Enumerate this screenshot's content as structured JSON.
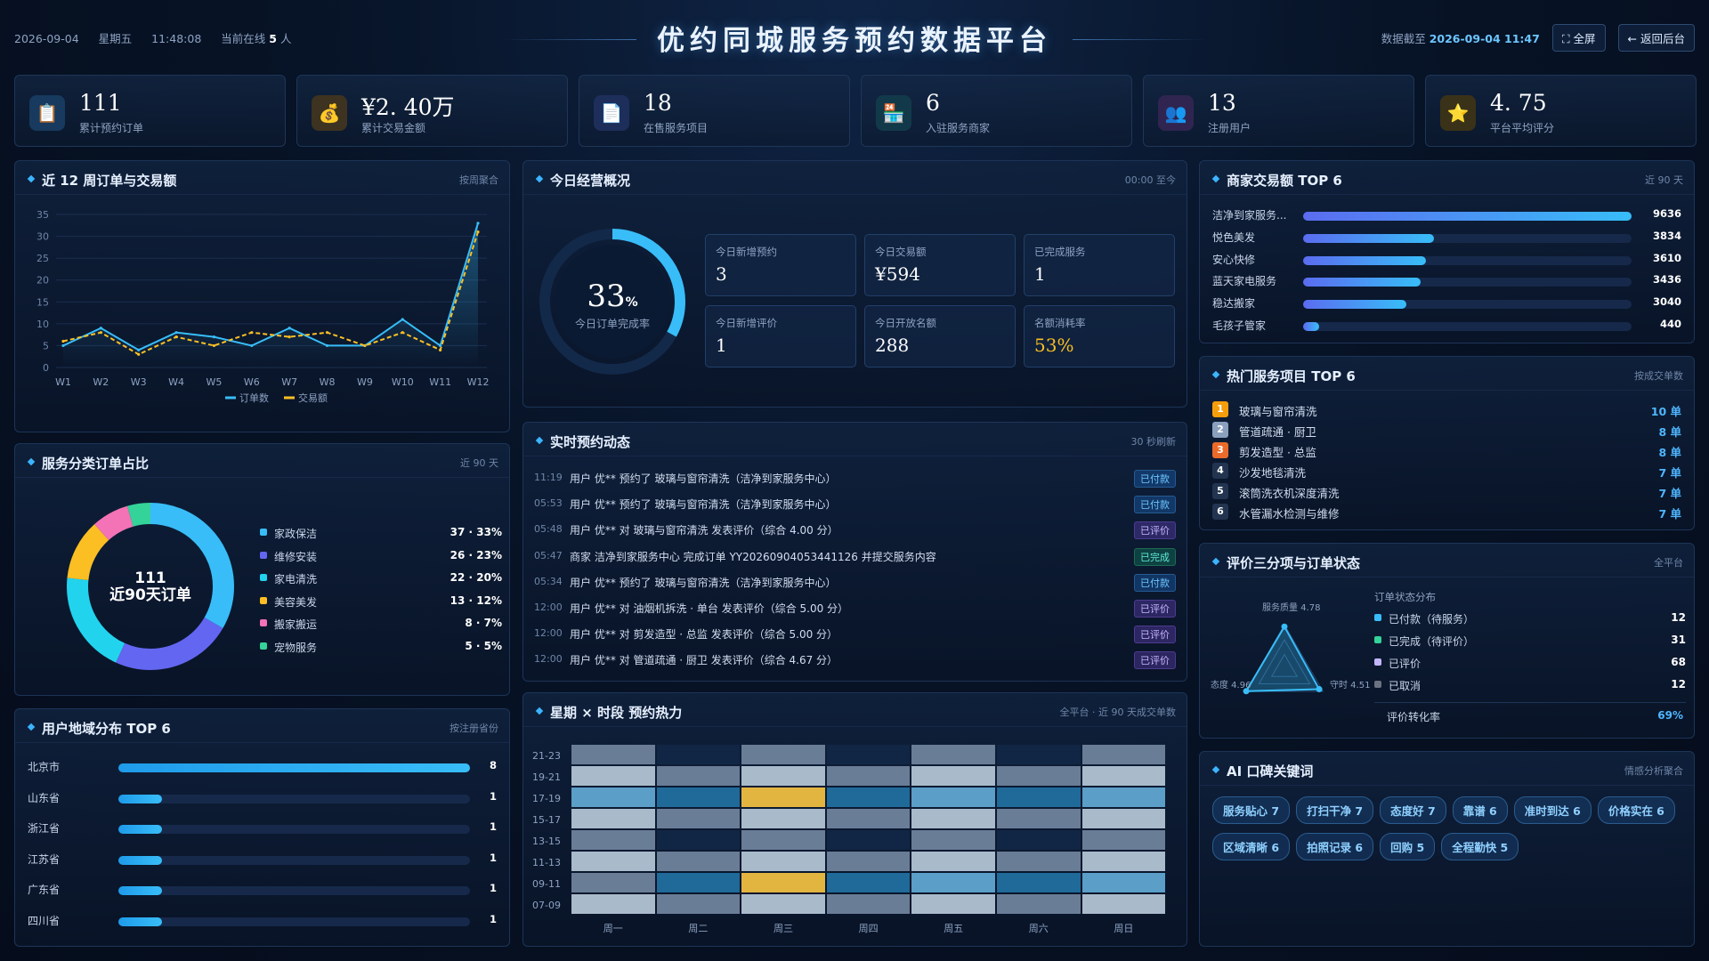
{
  "header": {
    "date": "2026-09-04",
    "weekday": "星期五",
    "time": "11:48:08",
    "online_prefix": "当前在线",
    "online_count": "5",
    "online_suffix": "人",
    "title": "优约同城服务预约数据平台",
    "data_as_of_label": "数据截至",
    "data_as_of": "2026-09-04 11:47",
    "fullscreen_label": "⛶ 全屏",
    "back_label": "← 返回后台"
  },
  "stats": [
    {
      "value": "111",
      "label": "累计预约订单",
      "icon": "clipboard-icon",
      "glyph": "📋",
      "bg": "#173a5e"
    },
    {
      "value": "¥2. 40万",
      "label": "累计交易金额",
      "icon": "money-bag-icon",
      "glyph": "💰",
      "bg": "#3d3320"
    },
    {
      "value": "18",
      "label": "在售服务项目",
      "icon": "document-icon",
      "glyph": "📄",
      "bg": "#1d2e5a"
    },
    {
      "value": "6",
      "label": "入驻服务商家",
      "icon": "store-icon",
      "glyph": "🏪",
      "bg": "#12394a"
    },
    {
      "value": "13",
      "label": "注册用户",
      "icon": "users-icon",
      "glyph": "👥",
      "bg": "#2f2550"
    },
    {
      "value": "4. 75",
      "label": "平台平均评分",
      "icon": "star-icon",
      "glyph": "⭐",
      "bg": "#3a3218"
    }
  ],
  "weekly": {
    "title": "近 12 周订单与交易额",
    "subtitle": "按周聚合",
    "legend_orders": "订单数",
    "legend_amount": "交易额"
  },
  "category": {
    "title": "服务分类订单占比",
    "subtitle": "近 90 天",
    "center_value": "111",
    "center_label": "近90天订单",
    "items": [
      {
        "name": "家政保洁",
        "count": 37,
        "pct": "33%",
        "display": "37 · 33%",
        "color": "#38bdf8"
      },
      {
        "name": "维修安装",
        "count": 26,
        "pct": "23%",
        "display": "26 · 23%",
        "color": "#6366f1"
      },
      {
        "name": "家电清洗",
        "count": 22,
        "pct": "20%",
        "display": "22 · 20%",
        "color": "#22d3ee"
      },
      {
        "name": "美容美发",
        "count": 13,
        "pct": "12%",
        "display": "13 · 12%",
        "color": "#fbbf24"
      },
      {
        "name": "搬家搬运",
        "count": 8,
        "pct": "7%",
        "display": "8 · 7%",
        "color": "#f472b6"
      },
      {
        "name": "宠物服务",
        "count": 5,
        "pct": "5%",
        "display": "5 · 5%",
        "color": "#34d399"
      }
    ]
  },
  "region": {
    "title": "用户地域分布 TOP 6",
    "subtitle": "按注册省份",
    "max": 8,
    "items": [
      {
        "name": "北京市",
        "value": 8
      },
      {
        "name": "山东省",
        "value": 1
      },
      {
        "name": "浙江省",
        "value": 1
      },
      {
        "name": "江苏省",
        "value": 1
      },
      {
        "name": "广东省",
        "value": 1
      },
      {
        "name": "四川省",
        "value": 1
      }
    ]
  },
  "today": {
    "title": "今日经营概况",
    "subtitle": "00:00 至今",
    "rate_value": "33",
    "rate_unit": "%",
    "rate_fraction": 0.33,
    "rate_label": "今日订单完成率",
    "kpis": [
      {
        "label": "今日新增预约",
        "value": "3",
        "color": "#ffffff"
      },
      {
        "label": "今日交易额",
        "value": "¥594",
        "color": "#ffffff"
      },
      {
        "label": "已完成服务",
        "value": "1",
        "color": "#ffffff"
      },
      {
        "label": "今日新增评价",
        "value": "1",
        "color": "#ffffff"
      },
      {
        "label": "今日开放名额",
        "value": "288",
        "color": "#ffffff"
      },
      {
        "label": "名额消耗率",
        "value": "53%",
        "color": "#fbbf24"
      }
    ]
  },
  "feed": {
    "title": "实时预约动态",
    "subtitle": "30 秒刷新",
    "items": [
      {
        "time": "11:19",
        "text": "用户 优** 预约了 玻璃与窗帘清洗（洁净到家服务中心）",
        "tag": "已付款",
        "kind": "paid"
      },
      {
        "time": "05:53",
        "text": "用户 优** 预约了 玻璃与窗帘清洗（洁净到家服务中心）",
        "tag": "已付款",
        "kind": "paid"
      },
      {
        "time": "05:48",
        "text": "用户 优** 对 玻璃与窗帘清洗 发表评价（综合 4.00 分）",
        "tag": "已评价",
        "kind": "review"
      },
      {
        "time": "05:47",
        "text": "商家 洁净到家服务中心 完成订单 YY20260904053441126 并提交服务内容",
        "tag": "已完成",
        "kind": "done"
      },
      {
        "time": "05:34",
        "text": "用户 优** 预约了 玻璃与窗帘清洗（洁净到家服务中心）",
        "tag": "已付款",
        "kind": "paid"
      },
      {
        "time": "12:00",
        "text": "用户 优** 对 油烟机拆洗 · 单台 发表评价（综合 5.00 分）",
        "tag": "已评价",
        "kind": "review"
      },
      {
        "time": "12:00",
        "text": "用户 优** 对 剪发造型 · 总监 发表评价（综合 5.00 分）",
        "tag": "已评价",
        "kind": "review"
      },
      {
        "time": "12:00",
        "text": "用户 优** 对 管道疏通 · 厨卫 发表评价（综合 4.67 分）",
        "tag": "已评价",
        "kind": "review"
      }
    ]
  },
  "heatmap": {
    "title": "星期 × 时段 预约热力",
    "subtitle": "全平台 · 近 90 天成交单数",
    "rows": [
      "21-23",
      "19-21",
      "17-19",
      "15-17",
      "13-15",
      "11-13",
      "09-11",
      "07-09"
    ],
    "cols": [
      "周一",
      "周二",
      "周三",
      "周四",
      "周五",
      "周六",
      "周日"
    ],
    "levels": [
      [
        1,
        0,
        1,
        0,
        1,
        0,
        1
      ],
      [
        2,
        1,
        2,
        1,
        2,
        1,
        2
      ],
      [
        3,
        4,
        5,
        4,
        3,
        4,
        3
      ],
      [
        2,
        1,
        2,
        1,
        2,
        1,
        2
      ],
      [
        1,
        0,
        1,
        0,
        1,
        0,
        1
      ],
      [
        2,
        1,
        2,
        1,
        2,
        1,
        2
      ],
      [
        1,
        4,
        5,
        4,
        3,
        4,
        3
      ],
      [
        2,
        1,
        2,
        1,
        2,
        1,
        2
      ]
    ]
  },
  "merchants": {
    "title": "商家交易额 TOP 6",
    "subtitle": "近 90 天",
    "max": 9636,
    "items": [
      {
        "name": "洁净到家服务...",
        "value": 9636
      },
      {
        "name": "悦色美发",
        "value": 3834
      },
      {
        "name": "安心快修",
        "value": 3610
      },
      {
        "name": "蓝天家电服务",
        "value": 3436
      },
      {
        "name": "稳达搬家",
        "value": 3040
      },
      {
        "name": "毛孩子管家",
        "value": 440
      }
    ]
  },
  "hot": {
    "title": "热门服务项目 TOP 6",
    "subtitle": "按成交单数",
    "unit": "单",
    "items": [
      {
        "rank": "1",
        "name": "玻璃与窗帘清洗",
        "value": "10 单",
        "color": "#f59e0b"
      },
      {
        "rank": "2",
        "name": "管道疏通 · 厨卫",
        "value": "8 单",
        "color": "#8aa0bc"
      },
      {
        "rank": "3",
        "name": "剪发造型 · 总监",
        "value": "8 单",
        "color": "#ea6a2a"
      },
      {
        "rank": "4",
        "name": "沙发地毯清洗",
        "value": "7 单",
        "color": "#22344f"
      },
      {
        "rank": "5",
        "name": "滚筒洗衣机深度清洗",
        "value": "7 单",
        "color": "#22344f"
      },
      {
        "rank": "6",
        "name": "水管漏水检测与维修",
        "value": "7 单",
        "color": "#22344f"
      }
    ]
  },
  "review": {
    "title": "评价三分项与订单状态",
    "subtitle": "全平台",
    "radar_top": "服务质量 4.78",
    "radar_left": "态度 4.96",
    "radar_right": "守时 4.51",
    "status_title": "订单状态分布",
    "status": [
      {
        "name": "已付款（待服务）",
        "value": "12",
        "color": "#38bdf8"
      },
      {
        "name": "已完成（待评价）",
        "value": "31",
        "color": "#34d399"
      },
      {
        "name": "已评价",
        "value": "68",
        "color": "#c4b5fd"
      },
      {
        "name": "已取消",
        "value": "12",
        "color": "#6b7280"
      }
    ],
    "conversion_label": "评价转化率",
    "conversion_value": "69%"
  },
  "keywords": {
    "title": "AI 口碑关键词",
    "subtitle": "情感分析聚合",
    "items": [
      "服务贴心 7",
      "打扫干净 7",
      "态度好 7",
      "靠谱 6",
      "准时到达 6",
      "价格实在 6",
      "区域清晰 6",
      "拍照记录 6",
      "回购 5",
      "全程勤快 5"
    ]
  },
  "chart_data": {
    "type": "line",
    "title": "近 12 周订单与交易额",
    "x": [
      "W1",
      "W2",
      "W3",
      "W4",
      "W5",
      "W6",
      "W7",
      "W8",
      "W9",
      "W10",
      "W11",
      "W12"
    ],
    "ylim": [
      0,
      35
    ],
    "yticks": [
      0,
      5,
      10,
      15,
      20,
      25,
      30,
      35
    ],
    "grid": true,
    "legend": "bottom",
    "series": [
      {
        "name": "订单数",
        "values": [
          5,
          9,
          4,
          8,
          7,
          5,
          9,
          5,
          5,
          11,
          5,
          33
        ],
        "color": "#38bdf8",
        "style": "solid"
      },
      {
        "name": "交易额",
        "values": [
          6,
          8,
          3,
          7,
          5,
          8,
          7,
          8,
          5,
          8,
          4,
          31
        ],
        "color": "#fbbf24",
        "style": "dashed"
      }
    ]
  }
}
